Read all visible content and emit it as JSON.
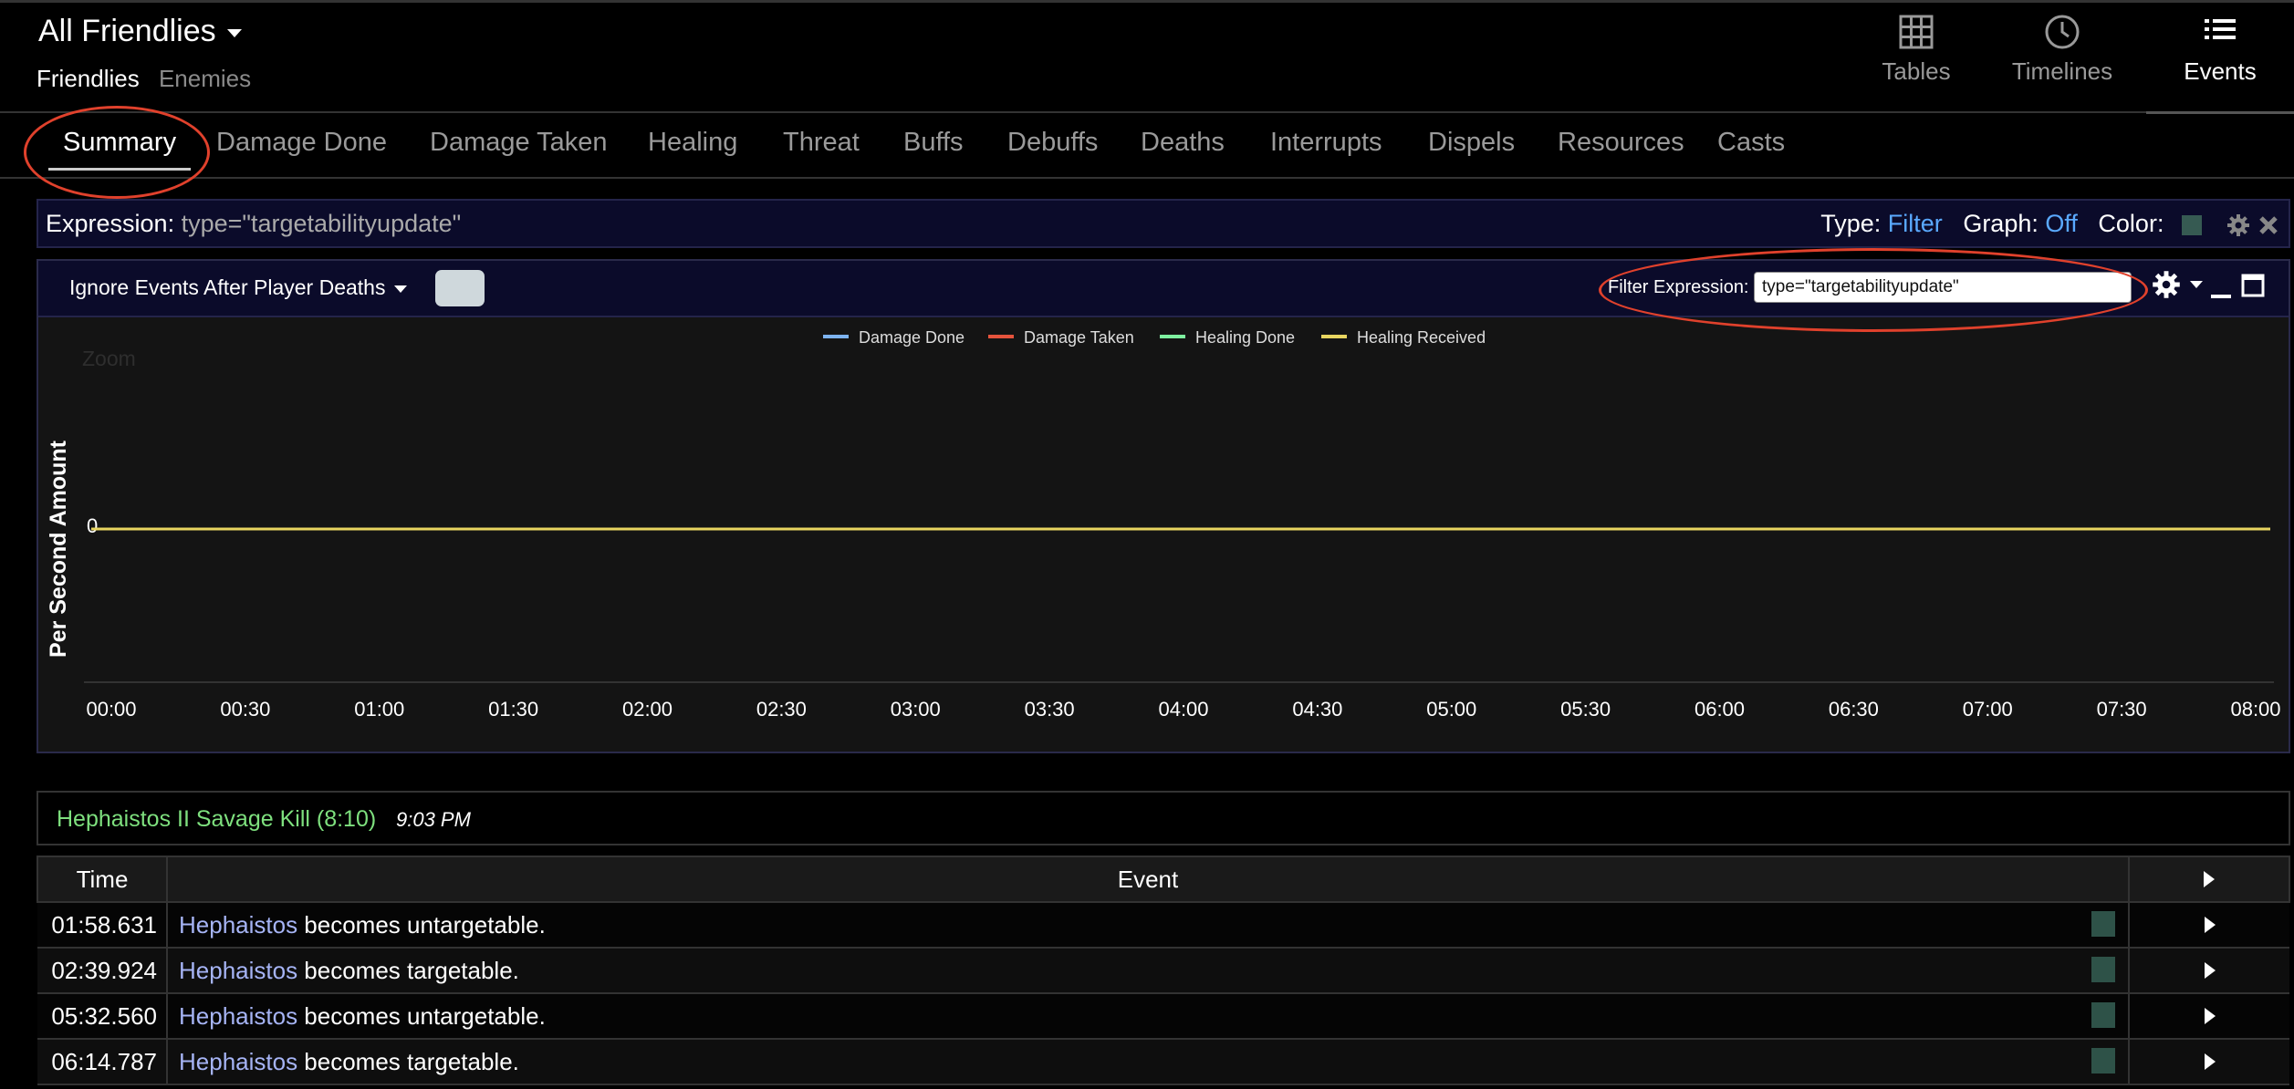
{
  "header": {
    "title": "All Friendlies",
    "subnav": [
      {
        "label": "Friendlies",
        "active": true
      },
      {
        "label": "Enemies",
        "active": false
      }
    ],
    "views": [
      {
        "label": "Tables",
        "icon": "table-grid-icon"
      },
      {
        "label": "Timelines",
        "icon": "clock-icon"
      },
      {
        "label": "Events",
        "icon": "list-icon",
        "active": true
      }
    ]
  },
  "tabs": [
    "Summary",
    "Damage Done",
    "Damage Taken",
    "Healing",
    "Threat",
    "Buffs",
    "Debuffs",
    "Deaths",
    "Interrupts",
    "Dispels",
    "Resources",
    "Casts"
  ],
  "active_tab": "Summary",
  "expression_bar": {
    "expression_label": "Expression:",
    "expression_value": "type=\"targetabilityupdate\"",
    "type_label": "Type:",
    "type_value": "Filter",
    "graph_label": "Graph:",
    "graph_value": "Off",
    "color_label": "Color:",
    "color_value": "#365a52"
  },
  "panel": {
    "ignore_dropdown": "Ignore Events After Player Deaths",
    "filter_label": "Filter Expression:",
    "filter_value": "type=\"targetabilityupdate\""
  },
  "chart_data": {
    "type": "line",
    "ylabel": "Per Second Amount",
    "xlabel": "",
    "title": "",
    "zoom_label": "Zoom",
    "x": [
      "00:00",
      "00:30",
      "01:00",
      "01:30",
      "02:00",
      "02:30",
      "03:00",
      "03:30",
      "04:00",
      "04:30",
      "05:00",
      "05:30",
      "06:00",
      "06:30",
      "07:00",
      "07:30",
      "08:00"
    ],
    "y_ticks": [
      "0"
    ],
    "grid": false,
    "legend_position": "top-center",
    "series": [
      {
        "name": "Damage Done",
        "color": "#7db3f0",
        "values": [
          0,
          0,
          0,
          0,
          0,
          0,
          0,
          0,
          0,
          0,
          0,
          0,
          0,
          0,
          0,
          0,
          0
        ]
      },
      {
        "name": "Damage Taken",
        "color": "#e5533c",
        "values": [
          0,
          0,
          0,
          0,
          0,
          0,
          0,
          0,
          0,
          0,
          0,
          0,
          0,
          0,
          0,
          0,
          0
        ]
      },
      {
        "name": "Healing Done",
        "color": "#7ef0a0",
        "values": [
          0,
          0,
          0,
          0,
          0,
          0,
          0,
          0,
          0,
          0,
          0,
          0,
          0,
          0,
          0,
          0,
          0
        ]
      },
      {
        "name": "Healing Received",
        "color": "#e8d560",
        "values": [
          0,
          0,
          0,
          0,
          0,
          0,
          0,
          0,
          0,
          0,
          0,
          0,
          0,
          0,
          0,
          0,
          0
        ]
      }
    ]
  },
  "fight": {
    "name": "Hephaistos II Savage Kill (8:10)",
    "time": "9:03 PM"
  },
  "events_table": {
    "headers": [
      "Time",
      "Event"
    ],
    "rows": [
      {
        "time": "01:58.631",
        "actor": "Hephaistos",
        "text": " becomes untargetable."
      },
      {
        "time": "02:39.924",
        "actor": "Hephaistos",
        "text": " becomes targetable."
      },
      {
        "time": "05:32.560",
        "actor": "Hephaistos",
        "text": " becomes untargetable."
      },
      {
        "time": "06:14.787",
        "actor": "Hephaistos",
        "text": " becomes targetable."
      }
    ]
  }
}
